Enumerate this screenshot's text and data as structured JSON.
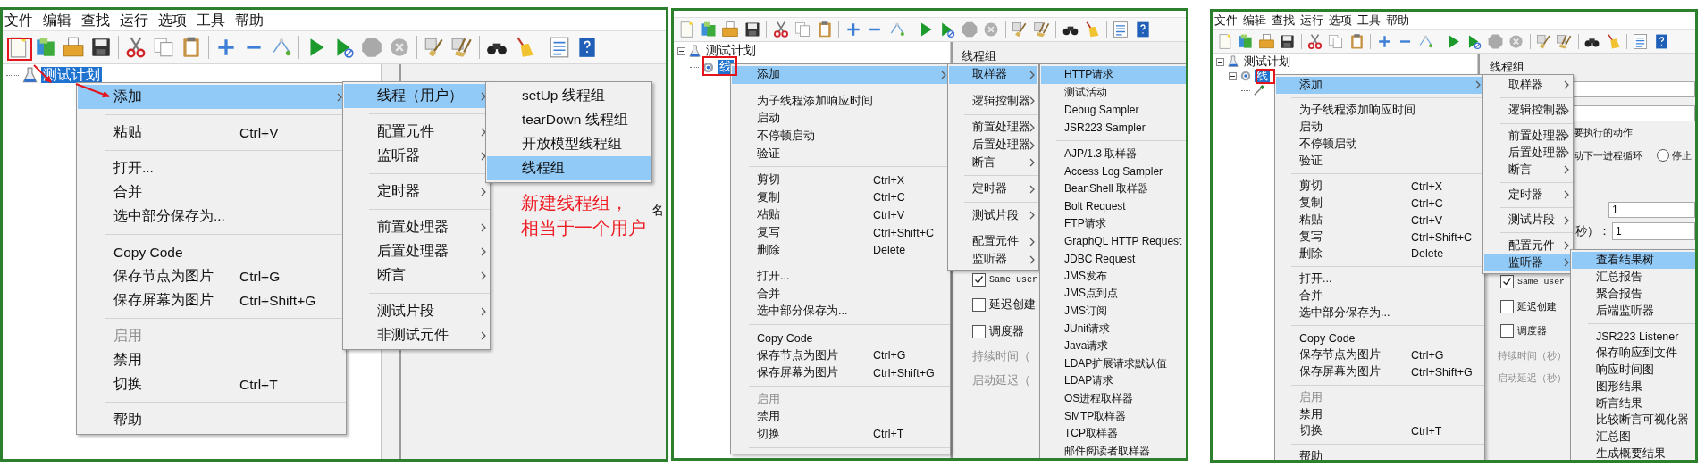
{
  "panels": [
    {
      "menubar": [
        "文件",
        "编辑",
        "查找",
        "运行",
        "选项",
        "工具",
        "帮助"
      ],
      "tree": [
        {
          "label": "测试计划",
          "selected": true
        }
      ],
      "menus": [
        {
          "items": [
            {
              "kind": "item",
              "label": "添加",
              "submenu": true,
              "selected": true,
              "disabled": false
            },
            {
              "kind": "separator"
            },
            {
              "kind": "item",
              "label": "粘贴",
              "shortcut": "Ctrl+V",
              "submenu": false,
              "selected": false,
              "disabled": false
            },
            {
              "kind": "separator"
            },
            {
              "kind": "item",
              "label": "打开...",
              "submenu": false,
              "selected": false,
              "disabled": false
            },
            {
              "kind": "item",
              "label": "合并",
              "submenu": false,
              "selected": false,
              "disabled": false
            },
            {
              "kind": "item",
              "label": "选中部分保存为...",
              "submenu": false,
              "selected": false,
              "disabled": false
            },
            {
              "kind": "separator"
            },
            {
              "kind": "item",
              "label": "Copy Code",
              "submenu": false,
              "selected": false,
              "disabled": false
            },
            {
              "kind": "item",
              "label": "保存节点为图片",
              "shortcut": "Ctrl+G",
              "submenu": false,
              "selected": false,
              "disabled": false
            },
            {
              "kind": "item",
              "label": "保存屏幕为图片",
              "shortcut": "Ctrl+Shift+G",
              "submenu": false,
              "selected": false,
              "disabled": false
            },
            {
              "kind": "separator"
            },
            {
              "kind": "item",
              "label": "启用",
              "submenu": false,
              "selected": false,
              "disabled": true
            },
            {
              "kind": "item",
              "label": "禁用",
              "submenu": false,
              "selected": false,
              "disabled": false
            },
            {
              "kind": "item",
              "label": "切换",
              "shortcut": "Ctrl+T",
              "submenu": false,
              "selected": false,
              "disabled": false
            },
            {
              "kind": "separator"
            },
            {
              "kind": "item",
              "label": "帮助",
              "submenu": false,
              "selected": false,
              "disabled": false
            }
          ]
        },
        {
          "items": [
            {
              "kind": "item",
              "label": "线程（用户）",
              "submenu": true,
              "selected": true,
              "disabled": false
            },
            {
              "kind": "separator"
            },
            {
              "kind": "item",
              "label": "配置元件",
              "submenu": true,
              "selected": false,
              "disabled": false
            },
            {
              "kind": "item",
              "label": "监听器",
              "submenu": true,
              "selected": false,
              "disabled": false
            },
            {
              "kind": "separator"
            },
            {
              "kind": "item",
              "label": "定时器",
              "submenu": true,
              "selected": false,
              "disabled": false
            },
            {
              "kind": "separator"
            },
            {
              "kind": "item",
              "label": "前置处理器",
              "submenu": true,
              "selected": false,
              "disabled": false
            },
            {
              "kind": "item",
              "label": "后置处理器",
              "submenu": true,
              "selected": false,
              "disabled": false
            },
            {
              "kind": "item",
              "label": "断言",
              "submenu": true,
              "selected": false,
              "disabled": false
            },
            {
              "kind": "separator"
            },
            {
              "kind": "item",
              "label": "测试片段",
              "submenu": true,
              "selected": false,
              "disabled": false
            },
            {
              "kind": "item",
              "label": "非测试元件",
              "submenu": true,
              "selected": false,
              "disabled": false
            }
          ]
        },
        {
          "items": [
            {
              "kind": "item",
              "label": "setUp 线程组",
              "submenu": false,
              "selected": false,
              "disabled": false
            },
            {
              "kind": "item",
              "label": "tearDown 线程组",
              "submenu": false,
              "selected": false,
              "disabled": false
            },
            {
              "kind": "item",
              "label": "开放模型线程组",
              "submenu": false,
              "selected": false,
              "disabled": false
            },
            {
              "kind": "item",
              "label": "线程组",
              "submenu": false,
              "selected": true,
              "disabled": false
            }
          ]
        }
      ],
      "form": [
        {
          "kind": "label",
          "text": "名",
          "disabled": false
        }
      ],
      "note": [
        "新建线程组，",
        "相当于一个用户"
      ]
    },
    {
      "tree": [
        {
          "label": "测试计划",
          "selected": false,
          "expanded": true,
          "children": [
            {
              "label": "线",
              "selected": true
            }
          ]
        }
      ],
      "menus": [
        {
          "items": [
            {
              "kind": "item",
              "label": "添加",
              "submenu": true,
              "selected": true,
              "disabled": false
            },
            {
              "kind": "separator"
            },
            {
              "kind": "item",
              "label": "为子线程添加响应时间",
              "submenu": false,
              "selected": false,
              "disabled": false
            },
            {
              "kind": "item",
              "label": "启动",
              "submenu": false,
              "selected": false,
              "disabled": false
            },
            {
              "kind": "item",
              "label": "不停顿启动",
              "submenu": false,
              "selected": false,
              "disabled": false
            },
            {
              "kind": "item",
              "label": "验证",
              "submenu": false,
              "selected": false,
              "disabled": false
            },
            {
              "kind": "separator"
            },
            {
              "kind": "item",
              "label": "剪切",
              "shortcut": "Ctrl+X",
              "submenu": false,
              "selected": false,
              "disabled": false
            },
            {
              "kind": "item",
              "label": "复制",
              "shortcut": "Ctrl+C",
              "submenu": false,
              "selected": false,
              "disabled": false
            },
            {
              "kind": "item",
              "label": "粘贴",
              "shortcut": "Ctrl+V",
              "submenu": false,
              "selected": false,
              "disabled": false
            },
            {
              "kind": "item",
              "label": "复写",
              "shortcut": "Ctrl+Shift+C",
              "submenu": false,
              "selected": false,
              "disabled": false
            },
            {
              "kind": "item",
              "label": "删除",
              "shortcut": "Delete",
              "submenu": false,
              "selected": false,
              "disabled": false
            },
            {
              "kind": "separator"
            },
            {
              "kind": "item",
              "label": "打开...",
              "submenu": false,
              "selected": false,
              "disabled": false
            },
            {
              "kind": "item",
              "label": "合并",
              "submenu": false,
              "selected": false,
              "disabled": false
            },
            {
              "kind": "item",
              "label": "选中部分保存为...",
              "submenu": false,
              "selected": false,
              "disabled": false
            },
            {
              "kind": "separator"
            },
            {
              "kind": "item",
              "label": "Copy Code",
              "submenu": false,
              "selected": false,
              "disabled": false
            },
            {
              "kind": "item",
              "label": "保存节点为图片",
              "shortcut": "Ctrl+G",
              "submenu": false,
              "selected": false,
              "disabled": false
            },
            {
              "kind": "item",
              "label": "保存屏幕为图片",
              "shortcut": "Ctrl+Shift+G",
              "submenu": false,
              "selected": false,
              "disabled": false
            },
            {
              "kind": "separator"
            },
            {
              "kind": "item",
              "label": "启用",
              "submenu": false,
              "selected": false,
              "disabled": true
            },
            {
              "kind": "item",
              "label": "禁用",
              "submenu": false,
              "selected": false,
              "disabled": false
            },
            {
              "kind": "item",
              "label": "切换",
              "shortcut": "Ctrl+T",
              "submenu": false,
              "selected": false,
              "disabled": false
            },
            {
              "kind": "separator"
            }
          ]
        },
        {
          "items": [
            {
              "kind": "item",
              "label": "取样器",
              "submenu": true,
              "selected": true,
              "disabled": false
            },
            {
              "kind": "separator"
            },
            {
              "kind": "item",
              "label": "逻辑控制器",
              "submenu": true,
              "selected": false,
              "disabled": false
            },
            {
              "kind": "separator"
            },
            {
              "kind": "item",
              "label": "前置处理器",
              "submenu": true,
              "selected": false,
              "disabled": false
            },
            {
              "kind": "item",
              "label": "后置处理器",
              "submenu": true,
              "selected": false,
              "disabled": false
            },
            {
              "kind": "item",
              "label": "断言",
              "submenu": true,
              "selected": false,
              "disabled": false
            },
            {
              "kind": "separator"
            },
            {
              "kind": "item",
              "label": "定时器",
              "submenu": true,
              "selected": false,
              "disabled": false
            },
            {
              "kind": "separator"
            },
            {
              "kind": "item",
              "label": "测试片段",
              "submenu": true,
              "selected": false,
              "disabled": false
            },
            {
              "kind": "separator"
            },
            {
              "kind": "item",
              "label": "配置元件",
              "submenu": true,
              "selected": false,
              "disabled": false
            },
            {
              "kind": "item",
              "label": "监听器",
              "submenu": true,
              "selected": false,
              "disabled": false
            }
          ]
        },
        {
          "items": [
            {
              "kind": "item",
              "label": "HTTP请求",
              "submenu": false,
              "selected": true,
              "disabled": false
            },
            {
              "kind": "item",
              "label": "测试活动",
              "submenu": false,
              "selected": false,
              "disabled": false
            },
            {
              "kind": "item",
              "label": "Debug Sampler",
              "submenu": false,
              "selected": false,
              "disabled": false
            },
            {
              "kind": "item",
              "label": "JSR223 Sampler",
              "submenu": false,
              "selected": false,
              "disabled": false
            },
            {
              "kind": "separator"
            },
            {
              "kind": "item",
              "label": "AJP/1.3 取样器",
              "submenu": false,
              "selected": false,
              "disabled": false
            },
            {
              "kind": "item",
              "label": "Access Log Sampler",
              "submenu": false,
              "selected": false,
              "disabled": false
            },
            {
              "kind": "item",
              "label": "BeanShell 取样器",
              "submenu": false,
              "selected": false,
              "disabled": false
            },
            {
              "kind": "item",
              "label": "Bolt Request",
              "submenu": false,
              "selected": false,
              "disabled": false
            },
            {
              "kind": "item",
              "label": "FTP请求",
              "submenu": false,
              "selected": false,
              "disabled": false
            },
            {
              "kind": "item",
              "label": "GraphQL HTTP Request",
              "submenu": false,
              "selected": false,
              "disabled": false
            },
            {
              "kind": "item",
              "label": "JDBC Request",
              "submenu": false,
              "selected": false,
              "disabled": false
            },
            {
              "kind": "item",
              "label": "JMS发布",
              "submenu": false,
              "selected": false,
              "disabled": false
            },
            {
              "kind": "item",
              "label": "JMS点到点",
              "submenu": false,
              "selected": false,
              "disabled": false
            },
            {
              "kind": "item",
              "label": "JMS订阅",
              "submenu": false,
              "selected": false,
              "disabled": false
            },
            {
              "kind": "item",
              "label": "JUnit请求",
              "submenu": false,
              "selected": false,
              "disabled": false
            },
            {
              "kind": "item",
              "label": "Java请求",
              "submenu": false,
              "selected": false,
              "disabled": false
            },
            {
              "kind": "item",
              "label": "LDAP扩展请求默认值",
              "submenu": false,
              "selected": false,
              "disabled": false
            },
            {
              "kind": "item",
              "label": "LDAP请求",
              "submenu": false,
              "selected": false,
              "disabled": false
            },
            {
              "kind": "item",
              "label": "OS进程取样器",
              "submenu": false,
              "selected": false,
              "disabled": false
            },
            {
              "kind": "item",
              "label": "SMTP取样器",
              "submenu": false,
              "selected": false,
              "disabled": false
            },
            {
              "kind": "item",
              "label": "TCP取样器",
              "submenu": false,
              "selected": false,
              "disabled": false
            },
            {
              "kind": "item",
              "label": "邮件阅读者取样器",
              "submenu": false,
              "selected": false,
              "disabled": false
            }
          ]
        }
      ],
      "form": [
        {
          "kind": "title",
          "text": "线程组"
        },
        {
          "kind": "checkbox",
          "label": "Same user",
          "checked": true
        },
        {
          "kind": "checkbox",
          "label": "延迟创建",
          "checked": false
        },
        {
          "kind": "checkbox",
          "label": "调度器",
          "checked": false
        },
        {
          "kind": "label",
          "text": "持续时间（",
          "disabled": true
        },
        {
          "kind": "label",
          "text": "启动延迟（",
          "disabled": true
        }
      ]
    },
    {
      "menubar": [
        "文件",
        "编辑",
        "查找",
        "运行",
        "选项",
        "工具",
        "帮助"
      ],
      "tree": [
        {
          "label": "测试计划",
          "selected": false,
          "expanded": true,
          "children": [
            {
              "label": "线",
              "selected": true,
              "expanded": true,
              "children": [
                {
                  "selected": false
                }
              ]
            }
          ]
        }
      ],
      "menus": [
        {
          "items": [
            {
              "kind": "item",
              "label": "添加",
              "submenu": true,
              "selected": true,
              "disabled": false
            },
            {
              "kind": "separator"
            },
            {
              "kind": "item",
              "label": "为子线程添加响应时间",
              "submenu": false,
              "selected": false,
              "disabled": false
            },
            {
              "kind": "item",
              "label": "启动",
              "submenu": false,
              "selected": false,
              "disabled": false
            },
            {
              "kind": "item",
              "label": "不停顿启动",
              "submenu": false,
              "selected": false,
              "disabled": false
            },
            {
              "kind": "item",
              "label": "验证",
              "submenu": false,
              "selected": false,
              "disabled": false
            },
            {
              "kind": "separator"
            },
            {
              "kind": "item",
              "label": "剪切",
              "shortcut": "Ctrl+X",
              "submenu": false,
              "selected": false,
              "disabled": false
            },
            {
              "kind": "item",
              "label": "复制",
              "shortcut": "Ctrl+C",
              "submenu": false,
              "selected": false,
              "disabled": false
            },
            {
              "kind": "item",
              "label": "粘贴",
              "shortcut": "Ctrl+V",
              "submenu": false,
              "selected": false,
              "disabled": false
            },
            {
              "kind": "item",
              "label": "复写",
              "shortcut": "Ctrl+Shift+C",
              "submenu": false,
              "selected": false,
              "disabled": false
            },
            {
              "kind": "item",
              "label": "删除",
              "shortcut": "Delete",
              "submenu": false,
              "selected": false,
              "disabled": false
            },
            {
              "kind": "separator"
            },
            {
              "kind": "item",
              "label": "打开...",
              "submenu": false,
              "selected": false,
              "disabled": false
            },
            {
              "kind": "item",
              "label": "合并",
              "submenu": false,
              "selected": false,
              "disabled": false
            },
            {
              "kind": "item",
              "label": "选中部分保存为...",
              "submenu": false,
              "selected": false,
              "disabled": false
            },
            {
              "kind": "separator"
            },
            {
              "kind": "item",
              "label": "Copy Code",
              "submenu": false,
              "selected": false,
              "disabled": false
            },
            {
              "kind": "item",
              "label": "保存节点为图片",
              "shortcut": "Ctrl+G",
              "submenu": false,
              "selected": false,
              "disabled": false
            },
            {
              "kind": "item",
              "label": "保存屏幕为图片",
              "shortcut": "Ctrl+Shift+G",
              "submenu": false,
              "selected": false,
              "disabled": false
            },
            {
              "kind": "separator"
            },
            {
              "kind": "item",
              "label": "启用",
              "submenu": false,
              "selected": false,
              "disabled": true
            },
            {
              "kind": "item",
              "label": "禁用",
              "submenu": false,
              "selected": false,
              "disabled": false
            },
            {
              "kind": "item",
              "label": "切换",
              "shortcut": "Ctrl+T",
              "submenu": false,
              "selected": false,
              "disabled": false
            },
            {
              "kind": "separator"
            },
            {
              "kind": "item",
              "label": "帮助",
              "submenu": false,
              "selected": false,
              "disabled": false
            }
          ]
        },
        {
          "items": [
            {
              "kind": "item",
              "label": "取样器",
              "submenu": true,
              "selected": false,
              "disabled": false
            },
            {
              "kind": "separator"
            },
            {
              "kind": "item",
              "label": "逻辑控制器",
              "submenu": true,
              "selected": false,
              "disabled": false
            },
            {
              "kind": "separator"
            },
            {
              "kind": "item",
              "label": "前置处理器",
              "submenu": true,
              "selected": false,
              "disabled": false
            },
            {
              "kind": "item",
              "label": "后置处理器",
              "submenu": true,
              "selected": false,
              "disabled": false
            },
            {
              "kind": "item",
              "label": "断言",
              "submenu": true,
              "selected": false,
              "disabled": false
            },
            {
              "kind": "separator"
            },
            {
              "kind": "item",
              "label": "定时器",
              "submenu": true,
              "selected": false,
              "disabled": false
            },
            {
              "kind": "separator"
            },
            {
              "kind": "item",
              "label": "测试片段",
              "submenu": true,
              "selected": false,
              "disabled": false
            },
            {
              "kind": "separator"
            },
            {
              "kind": "item",
              "label": "配置元件",
              "submenu": true,
              "selected": false,
              "disabled": false
            },
            {
              "kind": "item",
              "label": "监听器",
              "submenu": true,
              "selected": true,
              "disabled": false
            }
          ]
        },
        {
          "items": [
            {
              "kind": "item",
              "label": "查看结果树",
              "submenu": false,
              "selected": true,
              "disabled": false
            },
            {
              "kind": "item",
              "label": "汇总报告",
              "submenu": false,
              "selected": false,
              "disabled": false
            },
            {
              "kind": "item",
              "label": "聚合报告",
              "submenu": false,
              "selected": false,
              "disabled": false
            },
            {
              "kind": "item",
              "label": "后端监听器",
              "submenu": false,
              "selected": false,
              "disabled": false
            },
            {
              "kind": "separator"
            },
            {
              "kind": "item",
              "label": "JSR223 Listener",
              "submenu": false,
              "selected": false,
              "disabled": false
            },
            {
              "kind": "item",
              "label": "保存响应到文件",
              "submenu": false,
              "selected": false,
              "disabled": false
            },
            {
              "kind": "item",
              "label": "响应时间图",
              "submenu": false,
              "selected": false,
              "disabled": false
            },
            {
              "kind": "item",
              "label": "图形结果",
              "submenu": false,
              "selected": false,
              "disabled": false
            },
            {
              "kind": "item",
              "label": "断言结果",
              "submenu": false,
              "selected": false,
              "disabled": false
            },
            {
              "kind": "item",
              "label": "比较断言可视化器",
              "submenu": false,
              "selected": false,
              "disabled": false
            },
            {
              "kind": "item",
              "label": "汇总图",
              "submenu": false,
              "selected": false,
              "disabled": false
            },
            {
              "kind": "item",
              "label": "生成概要结果",
              "submenu": false,
              "selected": false,
              "disabled": false
            }
          ]
        }
      ],
      "form": [
        {
          "kind": "title",
          "text": "线程组"
        },
        {
          "kind": "input"
        },
        {
          "kind": "input"
        },
        {
          "kind": "label",
          "text": "要执行的动作",
          "disabled": false
        },
        {
          "kind": "radio_row",
          "text": "动下一进程循环",
          "option": {
            "label": "停止",
            "selected": false
          }
        },
        {
          "kind": "input",
          "value": "1"
        },
        {
          "kind": "input_row",
          "label": "秒）：",
          "value": "1"
        },
        {
          "kind": "checkbox",
          "label": "Same user",
          "checked": true
        },
        {
          "kind": "checkbox",
          "label": "延迟创建",
          "checked": false
        },
        {
          "kind": "checkbox",
          "label": "调度器",
          "checked": false
        },
        {
          "kind": "label",
          "text": "持续时间（秒）",
          "disabled": true
        },
        {
          "kind": "label",
          "text": "启动延迟（秒）",
          "disabled": true
        }
      ]
    }
  ]
}
